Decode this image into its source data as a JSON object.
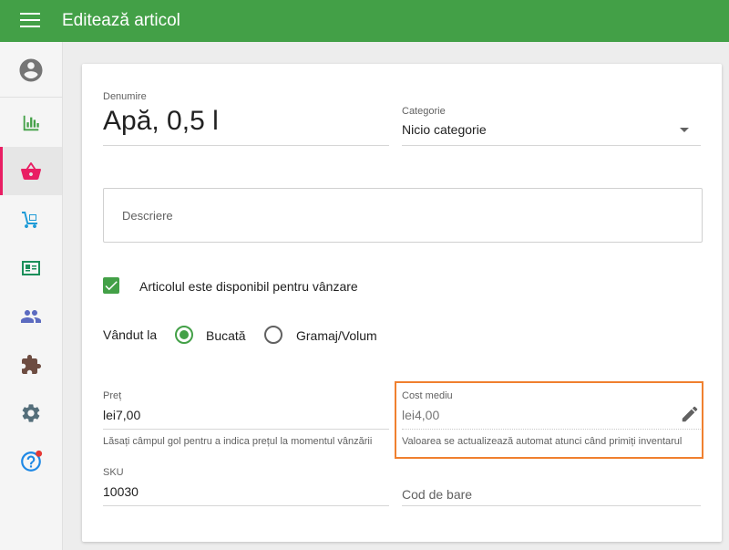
{
  "app": {
    "title": "Editează articol"
  },
  "sidebar": {
    "items": [
      {
        "icon": "account-circle-icon",
        "color": "#757575"
      },
      {
        "icon": "bar-chart-icon",
        "color": "#43a047"
      },
      {
        "icon": "shopping-basket-icon",
        "color": "#e91e63",
        "active": true
      },
      {
        "icon": "inventory-cart-icon",
        "color": "#1e9bd7"
      },
      {
        "icon": "employee-card-icon",
        "color": "#1b8f5a"
      },
      {
        "icon": "customers-icon",
        "color": "#5c6bc0"
      },
      {
        "icon": "integrations-puzzle-icon",
        "color": "#6d4c41"
      },
      {
        "icon": "settings-gear-icon",
        "color": "#546e7a"
      },
      {
        "icon": "help-icon",
        "color": "#1e88e5",
        "badge_color": "#e53935"
      }
    ]
  },
  "form": {
    "name": {
      "label": "Denumire",
      "value": "Apă, 0,5 l"
    },
    "category": {
      "label": "Categorie",
      "value": "Nicio categorie"
    },
    "description": {
      "placeholder": "Descriere"
    },
    "available": {
      "label": "Articolul este disponibil pentru vânzare",
      "checked": true
    },
    "sold_by": {
      "label": "Vândut la",
      "options": [
        "Bucată",
        "Gramaj/Volum"
      ],
      "selected": "Bucată"
    },
    "price": {
      "label": "Preț",
      "value": "lei7,00",
      "hint": "Lăsați câmpul gol pentru a indica prețul la momentul vânzării"
    },
    "cost": {
      "label": "Cost mediu",
      "value": "lei4,00",
      "hint": "Valoarea se actualizează automat atunci când primiți inventarul"
    },
    "sku": {
      "label": "SKU",
      "value": "10030"
    },
    "barcode": {
      "label": "Cod de bare",
      "value": ""
    }
  },
  "colors": {
    "primary": "#43a047",
    "accent": "#e91e63",
    "highlight": "#f0802f"
  }
}
